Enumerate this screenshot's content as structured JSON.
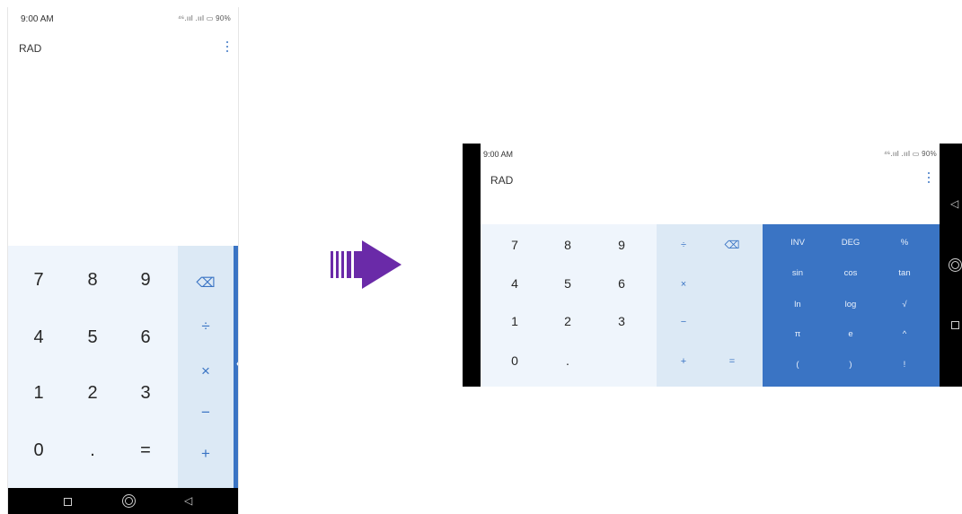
{
  "portrait": {
    "status": {
      "time": "9:00 AM",
      "signal": "⁴⁶.ııl .ııl ▭ 90%"
    },
    "mode": "RAD",
    "numpad": [
      "7",
      "8",
      "9",
      "4",
      "5",
      "6",
      "1",
      "2",
      "3",
      "0",
      ".",
      "="
    ],
    "ops": {
      "backspace": "⌫",
      "divide": "÷",
      "multiply": "×",
      "minus": "−",
      "plus": "+"
    },
    "expand": "‹"
  },
  "landscape": {
    "status": {
      "time": "9:00 AM",
      "signal": "⁴⁶.ııl .ııl ▭ 90%"
    },
    "mode": "RAD",
    "numpad": [
      "7",
      "8",
      "9",
      "4",
      "5",
      "6",
      "1",
      "2",
      "3",
      "0",
      "."
    ],
    "ops": {
      "divide": "÷",
      "backspace": "⌫",
      "multiply": "×",
      "minus": "−",
      "plus": "+",
      "equals": "="
    },
    "functions": [
      "INV",
      "DEG",
      "%",
      "sin",
      "cos",
      "tan",
      "ln",
      "log",
      "√",
      "π",
      "e",
      "^",
      "(",
      ")",
      "!"
    ]
  },
  "colors": {
    "accent": "#3a74c4",
    "numpad_bg": "#eff5fc",
    "ops_bg": "#dce9f5",
    "arrow": "#6a2aa8"
  }
}
